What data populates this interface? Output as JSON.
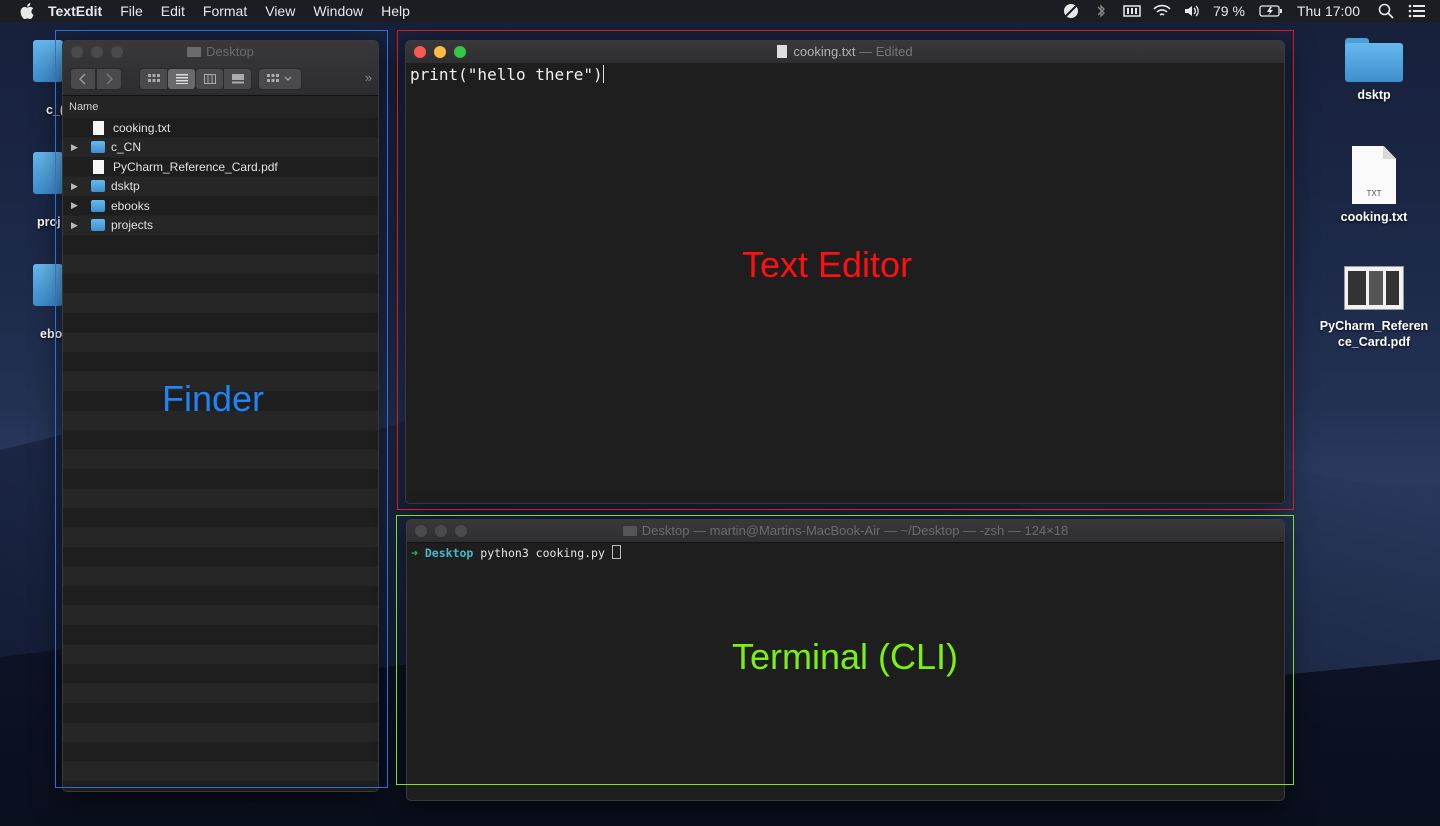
{
  "menubar": {
    "app_name": "TextEdit",
    "items": [
      "File",
      "Edit",
      "Format",
      "View",
      "Window",
      "Help"
    ],
    "battery": "79 %",
    "clock": "Thu 17:00"
  },
  "desktop_icons": {
    "right": [
      {
        "label": "dsktp",
        "type": "folder"
      },
      {
        "label": "cooking.txt",
        "type": "txt",
        "ext": "TXT"
      },
      {
        "label": "PyCharm_Referen ce_Card.pdf",
        "type": "pdf"
      }
    ],
    "left_partial": [
      {
        "label": "c_("
      },
      {
        "label": "proj"
      },
      {
        "label": "ebo"
      }
    ]
  },
  "finder": {
    "title": "Desktop",
    "column_header": "Name",
    "items": [
      {
        "name": "cooking.txt",
        "type": "doc",
        "expandable": false
      },
      {
        "name": "c_CN",
        "type": "folder",
        "expandable": true
      },
      {
        "name": "PyCharm_Reference_Card.pdf",
        "type": "doc",
        "expandable": false
      },
      {
        "name": "dsktp",
        "type": "folder",
        "expandable": true
      },
      {
        "name": "ebooks",
        "type": "folder",
        "expandable": true
      },
      {
        "name": "projects",
        "type": "folder",
        "expandable": true
      }
    ],
    "overlay_label": "Finder"
  },
  "editor": {
    "title": "cooking.txt",
    "title_status": "— Edited",
    "content": "print(\"hello there\")",
    "overlay_label": "Text Editor"
  },
  "terminal": {
    "title": "Desktop — martin@Martins-MacBook-Air — ~/Desktop — -zsh — 124×18",
    "prompt_arrow": "➜",
    "prompt_dir": "Desktop",
    "command": "python3 cooking.py",
    "overlay_label": "Terminal (CLI)"
  },
  "colors": {
    "finder_box": "#2d6fd6",
    "editor_box": "#d81a1a",
    "terminal_box": "#7be020"
  }
}
